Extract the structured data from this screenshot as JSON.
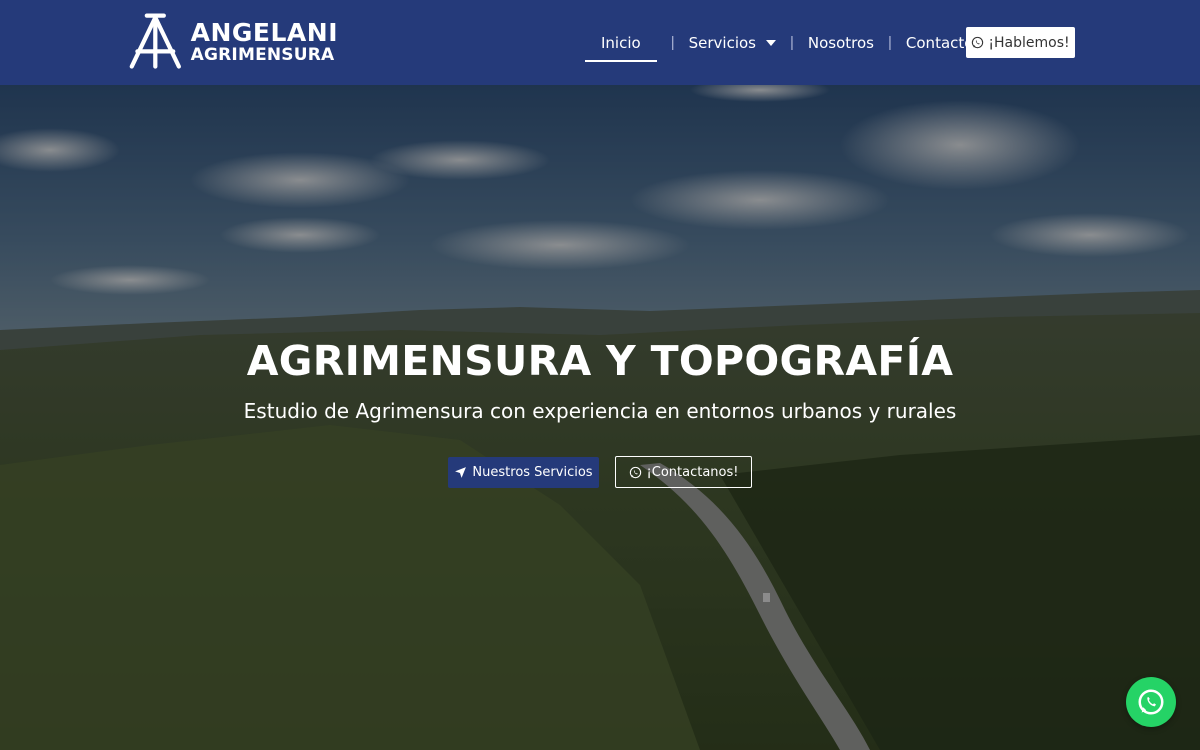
{
  "brand": {
    "name_line1": "ANGELANI",
    "name_line2": "AGRIMENSURA",
    "logo_icon": "compass-a-icon"
  },
  "nav": {
    "items": [
      {
        "label": "Inicio",
        "active": true
      },
      {
        "label": "Servicios",
        "has_dropdown": true
      },
      {
        "label": "Nosotros"
      },
      {
        "label": "Contacto"
      }
    ],
    "separator": "|",
    "cta_label": "¡Hablemos!",
    "cta_icon": "whatsapp-icon"
  },
  "hero": {
    "title": "AGRIMENSURA Y TOPOGRAFÍA",
    "subtitle": "Estudio de Agrimensura con experiencia en entornos urbanos y rurales",
    "primary_button": {
      "label": "Nuestros Servicios",
      "icon": "paper-plane-icon"
    },
    "secondary_button": {
      "label": "¡Contactanos!",
      "icon": "whatsapp-icon"
    }
  },
  "floating": {
    "icon": "whatsapp-icon"
  },
  "colors": {
    "brand_blue": "#253a7a",
    "whatsapp_green": "#25d366",
    "text_light": "#ffffff"
  }
}
